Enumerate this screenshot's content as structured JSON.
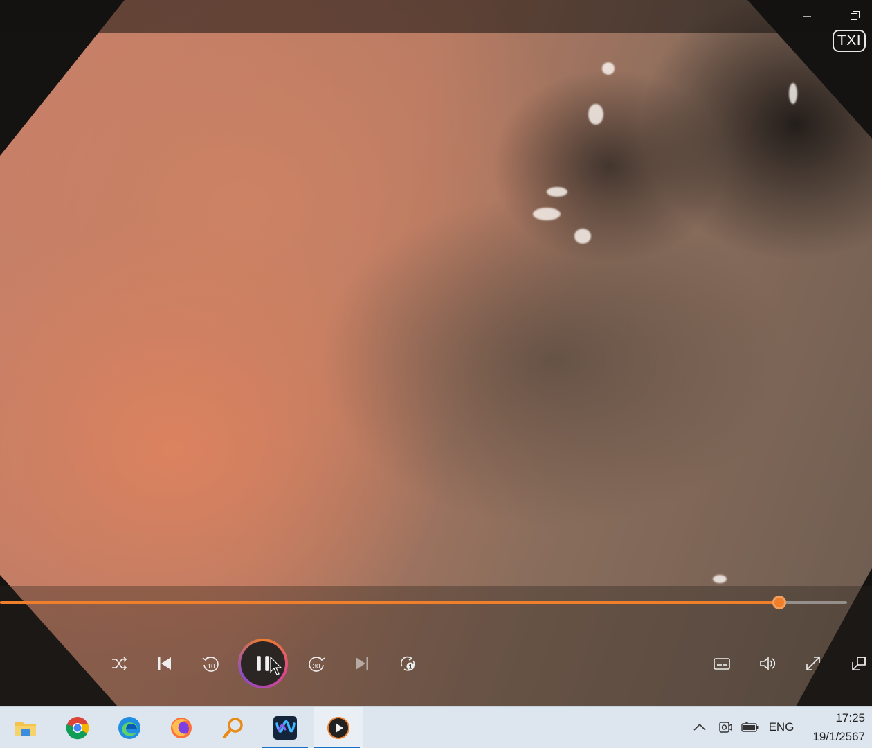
{
  "window": {
    "minimize_icon": "minimize-icon",
    "restore_icon": "restore-icon",
    "overlay_label": "TXI"
  },
  "playback": {
    "progress": 0.92,
    "state": "playing",
    "accent_color": "#ef7f2a"
  },
  "controls": {
    "left": [
      "shuffle-icon",
      "previous-icon",
      "rewind-10-icon",
      "pause-icon",
      "forward-30-icon",
      "next-icon",
      "repeat-one-icon"
    ],
    "right": [
      "subtitles-icon",
      "volume-icon",
      "fullscreen-icon",
      "miniplayer-icon"
    ],
    "rewind_seconds": "10",
    "forward_seconds": "30",
    "repeat_badge": "1"
  },
  "taskbar": {
    "apps": [
      {
        "name": "file-explorer-icon"
      },
      {
        "name": "chrome-icon"
      },
      {
        "name": "edge-icon"
      },
      {
        "name": "firefox-icon"
      },
      {
        "name": "search-magnifier-icon"
      },
      {
        "name": "wave-app-icon",
        "active": true
      },
      {
        "name": "media-player-icon",
        "active": true,
        "open": true
      }
    ],
    "tray": {
      "language": "ENG",
      "time": "17:25",
      "date": "19/1/2567"
    }
  }
}
